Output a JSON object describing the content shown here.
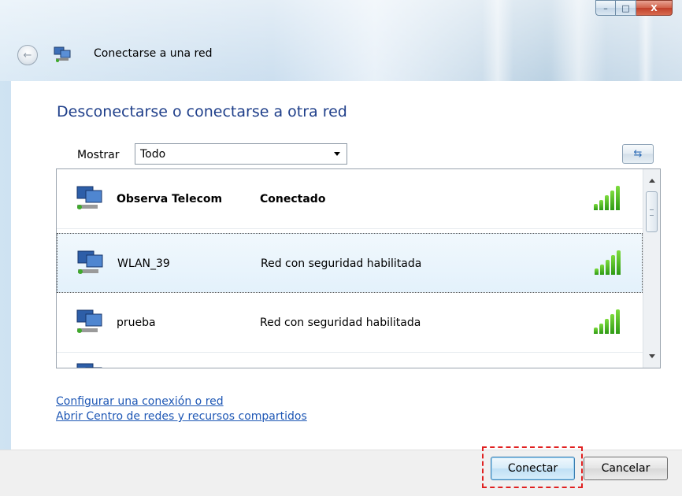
{
  "window": {
    "title": "Conectarse a una red",
    "controls": {
      "minimize": "–",
      "maximize": "□",
      "close": "X"
    }
  },
  "main": {
    "heading": "Desconectarse o conectarse a otra red",
    "filter": {
      "label": "Mostrar",
      "selected": "Todo"
    },
    "networks": [
      {
        "name": "Observa Telecom",
        "status": "Conectado",
        "bold": true,
        "selected": false,
        "signal_bars": 5
      },
      {
        "name": "WLAN_39",
        "status": "Red con seguridad habilitada",
        "bold": false,
        "selected": true,
        "signal_bars": 5
      },
      {
        "name": "prueba",
        "status": "Red con seguridad habilitada",
        "bold": false,
        "selected": false,
        "signal_bars": 5
      }
    ]
  },
  "links": {
    "setup": "Configurar una conexión o red",
    "center": "Abrir Centro de redes y recursos compartidos"
  },
  "footer": {
    "connect_label": "Conectar",
    "cancel_label": "Cancelar"
  },
  "icons": {
    "back": "back-arrow-icon",
    "network": "network-computer-icon",
    "refresh": "refresh-icon",
    "signal": "signal-strength-icon"
  },
  "colors": {
    "heading": "#1f3f8a",
    "link": "#1e57b5",
    "signal": "#2e9a15",
    "highlight": "#e02020"
  }
}
